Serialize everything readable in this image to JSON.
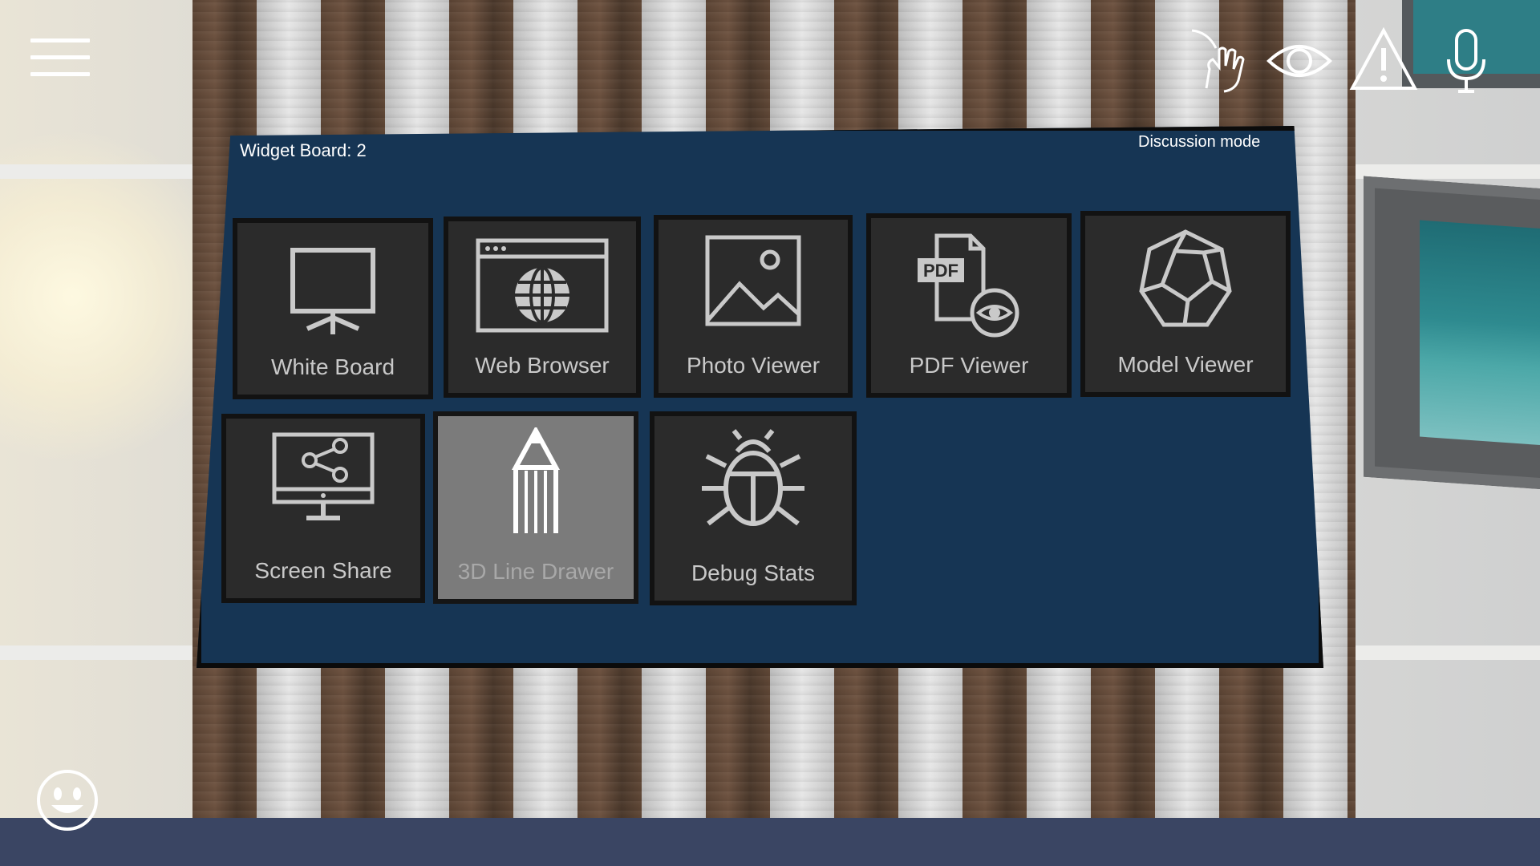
{
  "hud": {
    "menu_icon": "hamburger-menu-icon",
    "right_icons": [
      "hand-raise-icon",
      "eye-icon",
      "warning-icon",
      "microphone-icon"
    ],
    "bottom_left_icon": "smiley-face-icon"
  },
  "board": {
    "title": "Widget Board:  2",
    "mode": "Discussion mode",
    "background_color": "#163554",
    "tiles": [
      {
        "label": "White Board",
        "icon": "presentation-board-icon",
        "enabled": true
      },
      {
        "label": "Web Browser",
        "icon": "web-browser-globe-icon",
        "enabled": true
      },
      {
        "label": "Photo Viewer",
        "icon": "photo-icon",
        "enabled": true
      },
      {
        "label": "PDF Viewer",
        "icon": "pdf-viewer-icon",
        "enabled": true
      },
      {
        "label": "Model Viewer",
        "icon": "polyhedron-icon",
        "enabled": true
      },
      {
        "label": "Screen Share",
        "icon": "screen-share-icon",
        "enabled": true
      },
      {
        "label": "3D Line Drawer",
        "icon": "pencil-icon",
        "enabled": false
      },
      {
        "label": "Debug Stats",
        "icon": "bug-icon",
        "enabled": true
      }
    ]
  }
}
